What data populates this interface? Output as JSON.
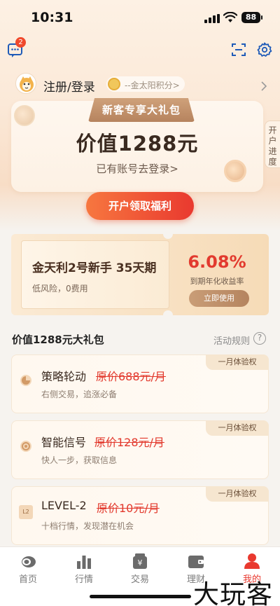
{
  "status_bar": {
    "time": "10:31",
    "battery": "88"
  },
  "header": {
    "message_badge": "2"
  },
  "profile": {
    "login_label": "注册/登录",
    "points_label": "--金太阳积分>"
  },
  "gift_card": {
    "banner": "新客专享大礼包",
    "value": "价值1288元",
    "login_link": "已有账号去登录>",
    "side_tab": "开户进度",
    "cta": "开户领取福利"
  },
  "voucher": {
    "title": "金天利2号新手 35天期",
    "subtitle": "低风险，0费用",
    "rate": "6.08%",
    "rate_label": "到期年化收益率",
    "button": "立即使用"
  },
  "section": {
    "title": "价值1288元大礼包",
    "rules": "活动规则",
    "rules_icon": "?"
  },
  "benefits": [
    {
      "name": "策略轮动",
      "price": "原价688元/月",
      "desc": "右侧交易，追涨必备",
      "tag": "一月体验权",
      "icon": "strategy-icon"
    },
    {
      "name": "智能信号",
      "price": "原价128元/月",
      "desc": "快人一步，获取信息",
      "tag": "一月体验权",
      "icon": "signal-icon"
    },
    {
      "name": "LEVEL-2",
      "price": "原价10元/月",
      "desc": "十档行情，发现潜在机会",
      "tag": "一月体验权",
      "icon": "level2-icon",
      "icon_text": "L2"
    }
  ],
  "nav": [
    {
      "label": "首页",
      "icon": "home-icon",
      "active": false
    },
    {
      "label": "行情",
      "icon": "market-icon",
      "active": false
    },
    {
      "label": "交易",
      "icon": "trade-icon",
      "active": false
    },
    {
      "label": "理财",
      "icon": "wealth-icon",
      "active": false
    },
    {
      "label": "我的",
      "icon": "profile-icon",
      "active": true
    }
  ],
  "watermark": "大玩客",
  "colors": {
    "accent": "#e9392f",
    "gold": "#b6835e",
    "cream": "#fdf1e4"
  }
}
